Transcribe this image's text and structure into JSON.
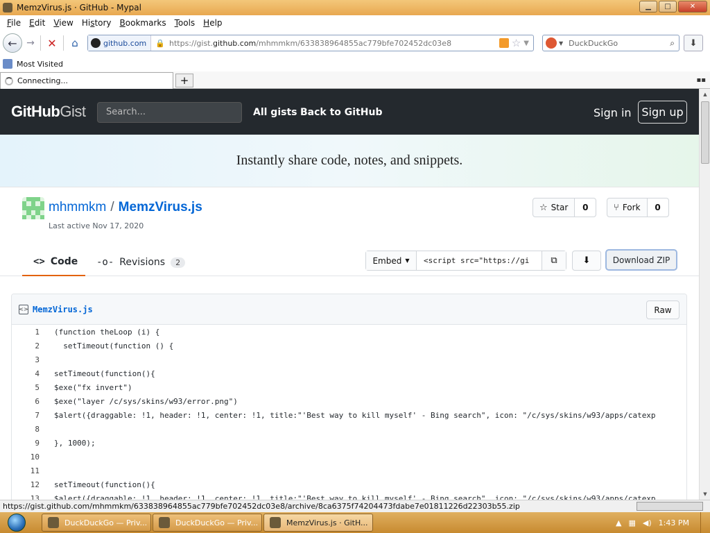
{
  "window": {
    "title": "MemzVirus.js · GitHub - Mypal",
    "minimize_glyph": "▁",
    "maximize_glyph": "□",
    "close_glyph": "✕"
  },
  "menu": [
    "File",
    "Edit",
    "View",
    "History",
    "Bookmarks",
    "Tools",
    "Help"
  ],
  "menu_underline": [
    "F",
    "E",
    "V",
    "s",
    "B",
    "T",
    "H"
  ],
  "nav": {
    "back_glyph": "←",
    "forward_glyph": "→",
    "stop_glyph": "✕",
    "home_glyph": "⌂",
    "site_identity": "github.com",
    "url_prefix": "https://gist.",
    "url_domain": "github.com",
    "url_path": "/mhmmkm/633838964855ac779bfe702452dc03e8",
    "search_placeholder": "DuckDuckGo",
    "download_glyph": "⬇"
  },
  "bookmarks": {
    "most_visited": "Most Visited"
  },
  "tab": {
    "label": "Connecting...",
    "new_tab_glyph": "+"
  },
  "gist_header": {
    "logo_bold": "GitHub",
    "logo_light": "Gist",
    "search_placeholder": "Search...",
    "all_gists": "All gists",
    "back_to_github": "Back to GitHub",
    "sign_in": "Sign in",
    "sign_up": "Sign up"
  },
  "banner": {
    "text": "Instantly share code, notes, and snippets."
  },
  "gist": {
    "owner": "mhmmkm",
    "separator": "/",
    "filename": "MemzVirus.js",
    "last_active": "Last active Nov 17, 2020",
    "star_label": "Star",
    "star_count": "0",
    "fork_label": "Fork",
    "fork_count": "0"
  },
  "tabs": {
    "code_label": "Code",
    "code_icon": "<>",
    "revisions_label": "Revisions",
    "revisions_count": "2",
    "embed_label": "Embed",
    "embed_value": "<script src=\"https://gi",
    "download_zip": "Download ZIP"
  },
  "file": {
    "name": "MemzVirus.js",
    "raw_label": "Raw",
    "lines": [
      {
        "n": "1",
        "t": "(function theLoop (i) {"
      },
      {
        "n": "2",
        "t": "  setTimeout(function () {"
      },
      {
        "n": "3",
        "t": ""
      },
      {
        "n": "4",
        "t": "setTimeout(function(){"
      },
      {
        "n": "5",
        "t": "$exe(\"fx invert\")"
      },
      {
        "n": "6",
        "t": "$exe(\"layer /c/sys/skins/w93/error.png\")"
      },
      {
        "n": "7",
        "t": "$alert({draggable: !1, header: !1, center: !1, title:\"'Best way to kill myself' - Bing search\", icon: \"/c/sys/skins/w93/apps/catexp"
      },
      {
        "n": "8",
        "t": ""
      },
      {
        "n": "9",
        "t": "}, 1000);"
      },
      {
        "n": "10",
        "t": ""
      },
      {
        "n": "11",
        "t": ""
      },
      {
        "n": "12",
        "t": "setTimeout(function(){"
      },
      {
        "n": "13",
        "t": "$alert({draggable: !1, header: !1, center: !1, title:\"'Best way to kill myself' - Bing search\", icon: \"/c/sys/skins/w93/apps/catexp"
      }
    ]
  },
  "status": {
    "url": "https://gist.github.com/mhmmkm/633838964855ac779bfe702452dc03e8/archive/8ca6375f74204473fdabe7e01811226d22303b55.zip"
  },
  "taskbar": {
    "tasks": [
      "DuckDuckGo — Priv...",
      "DuckDuckGo — Priv...",
      "MemzVirus.js · GitH..."
    ],
    "time": "1:43 PM"
  }
}
